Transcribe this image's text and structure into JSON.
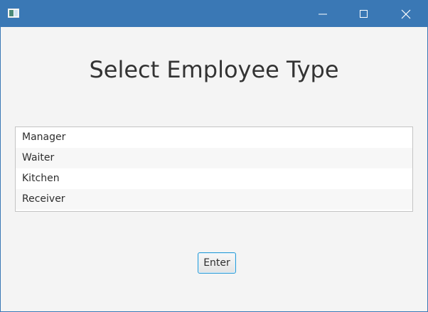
{
  "window": {
    "icon": "java-app-icon",
    "controls": [
      "minimize-icon",
      "maximize-icon",
      "close-icon"
    ],
    "titlebar_color": "#3a78b5"
  },
  "main": {
    "title": "Select Employee Type",
    "employee_types": [
      "Manager",
      "Waiter",
      "Kitchen",
      "Receiver"
    ],
    "enter_label": "Enter"
  },
  "colors": {
    "focus_border": "#2a9bd6",
    "background": "#f4f4f4"
  }
}
